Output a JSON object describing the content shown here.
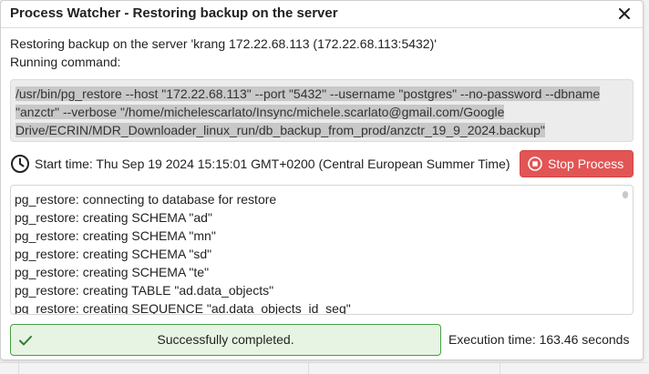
{
  "dialog": {
    "title": "Process Watcher - Restoring backup on the server",
    "message": "Restoring backup on the server 'krang 172.22.68.113 (172.22.68.113:5432)'",
    "running_label": "Running command:",
    "command": "/usr/bin/pg_restore --host \"172.22.68.113\" --port \"5432\" --username \"postgres\" --no-password --dbname \"anzctr\" --verbose \"/home/michelescarlato/Insync/michele.scarlato@gmail.com/Google Drive/ECRIN/MDR_Downloader_linux_run/db_backup_from_prod/anzctr_19_9_2024.backup\"",
    "start_time": "Start time: Thu Sep 19 2024 15:15:01 GMT+0200 (Central European Summer Time)",
    "stop_button_label": "Stop Process",
    "log_lines": [
      "pg_restore: connecting to database for restore",
      "pg_restore: creating SCHEMA \"ad\"",
      "pg_restore: creating SCHEMA \"mn\"",
      "pg_restore: creating SCHEMA \"sd\"",
      "pg_restore: creating SCHEMA \"te\"",
      "pg_restore: creating TABLE \"ad.data_objects\"",
      "pg_restore: creating SEQUENCE \"ad.data_objects_id_seq\""
    ],
    "status_text": "Successfully completed.",
    "execution_time": "Execution time: 163.46 seconds"
  },
  "icons": {
    "close": "close-icon",
    "clock": "clock-icon",
    "stop": "stop-circle-icon",
    "success": "check-icon"
  },
  "colors": {
    "stop_button": "#e25555",
    "success_border": "#47a046",
    "success_background": "#e7f4e4",
    "command_background": "#ececec",
    "command_highlight": "#c8c8c8"
  }
}
